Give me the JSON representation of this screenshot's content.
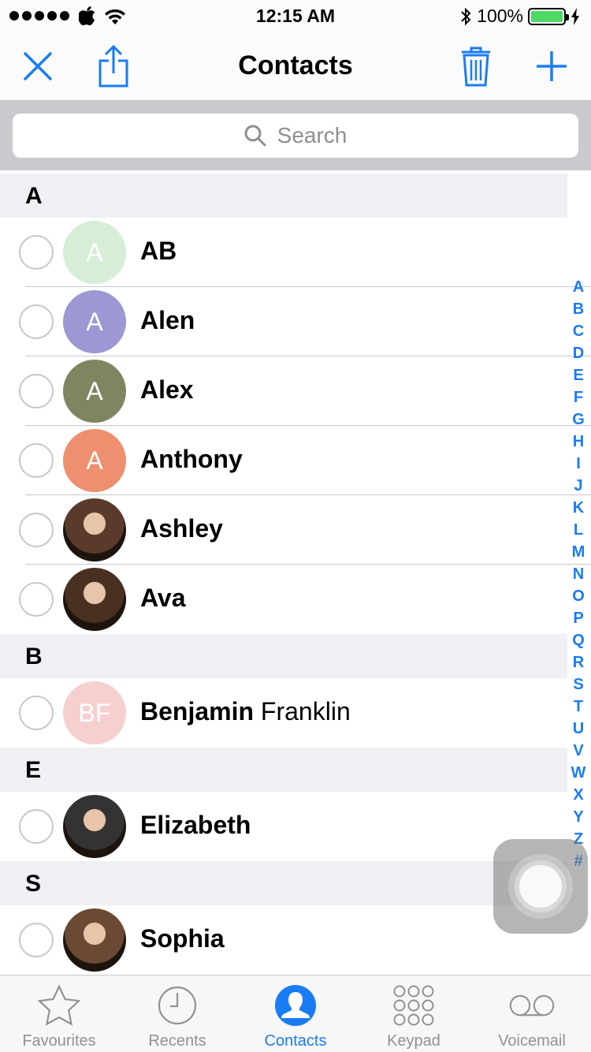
{
  "status_bar": {
    "time": "12:15 AM",
    "battery": "100%"
  },
  "nav": {
    "title": "Contacts",
    "close_icon": "close-icon",
    "share_icon": "share-icon",
    "trash_icon": "trash-icon",
    "add_icon": "plus-icon"
  },
  "search": {
    "placeholder": "Search"
  },
  "sections": [
    {
      "letter": "A",
      "contacts": [
        {
          "first": "AB",
          "last": "",
          "initials": "A",
          "avatar_color": "#d6eed6",
          "photo": false
        },
        {
          "first": "Alen",
          "last": "",
          "initials": "A",
          "avatar_color": "#9b98d4",
          "photo": false
        },
        {
          "first": "Alex",
          "last": "",
          "initials": "A",
          "avatar_color": "#7f8560",
          "photo": false
        },
        {
          "first": "Anthony",
          "last": "",
          "initials": "A",
          "avatar_color": "#ee9070",
          "photo": false
        },
        {
          "first": "Ashley",
          "last": "",
          "initials": "",
          "avatar_color": "#5a3a2a",
          "photo": true
        },
        {
          "first": "Ava",
          "last": "",
          "initials": "",
          "avatar_color": "#4a3020",
          "photo": true
        }
      ]
    },
    {
      "letter": "B",
      "contacts": [
        {
          "first": "Benjamin",
          "last": "Franklin",
          "initials": "BF",
          "avatar_color": "#f6cfcf",
          "photo": false
        }
      ]
    },
    {
      "letter": "E",
      "contacts": [
        {
          "first": "Elizabeth",
          "last": "",
          "initials": "",
          "avatar_color": "#333333",
          "photo": true
        }
      ]
    },
    {
      "letter": "S",
      "contacts": [
        {
          "first": "Sophia",
          "last": "",
          "initials": "",
          "avatar_color": "#6a4a35",
          "photo": true
        }
      ]
    }
  ],
  "index_letters": [
    "A",
    "B",
    "C",
    "D",
    "E",
    "F",
    "G",
    "H",
    "I",
    "J",
    "K",
    "L",
    "M",
    "N",
    "O",
    "P",
    "Q",
    "R",
    "S",
    "T",
    "U",
    "V",
    "W",
    "X",
    "Y",
    "Z",
    "#"
  ],
  "tabs": [
    {
      "label": "Favourites",
      "icon": "star-icon",
      "active": false
    },
    {
      "label": "Recents",
      "icon": "clock-icon",
      "active": false
    },
    {
      "label": "Contacts",
      "icon": "person-icon",
      "active": true
    },
    {
      "label": "Keypad",
      "icon": "keypad-icon",
      "active": false
    },
    {
      "label": "Voicemail",
      "icon": "voicemail-icon",
      "active": false
    }
  ],
  "colors": {
    "accent": "#1a7cf5",
    "section_bg": "#efeff4",
    "search_bg": "#c9c9ce"
  }
}
